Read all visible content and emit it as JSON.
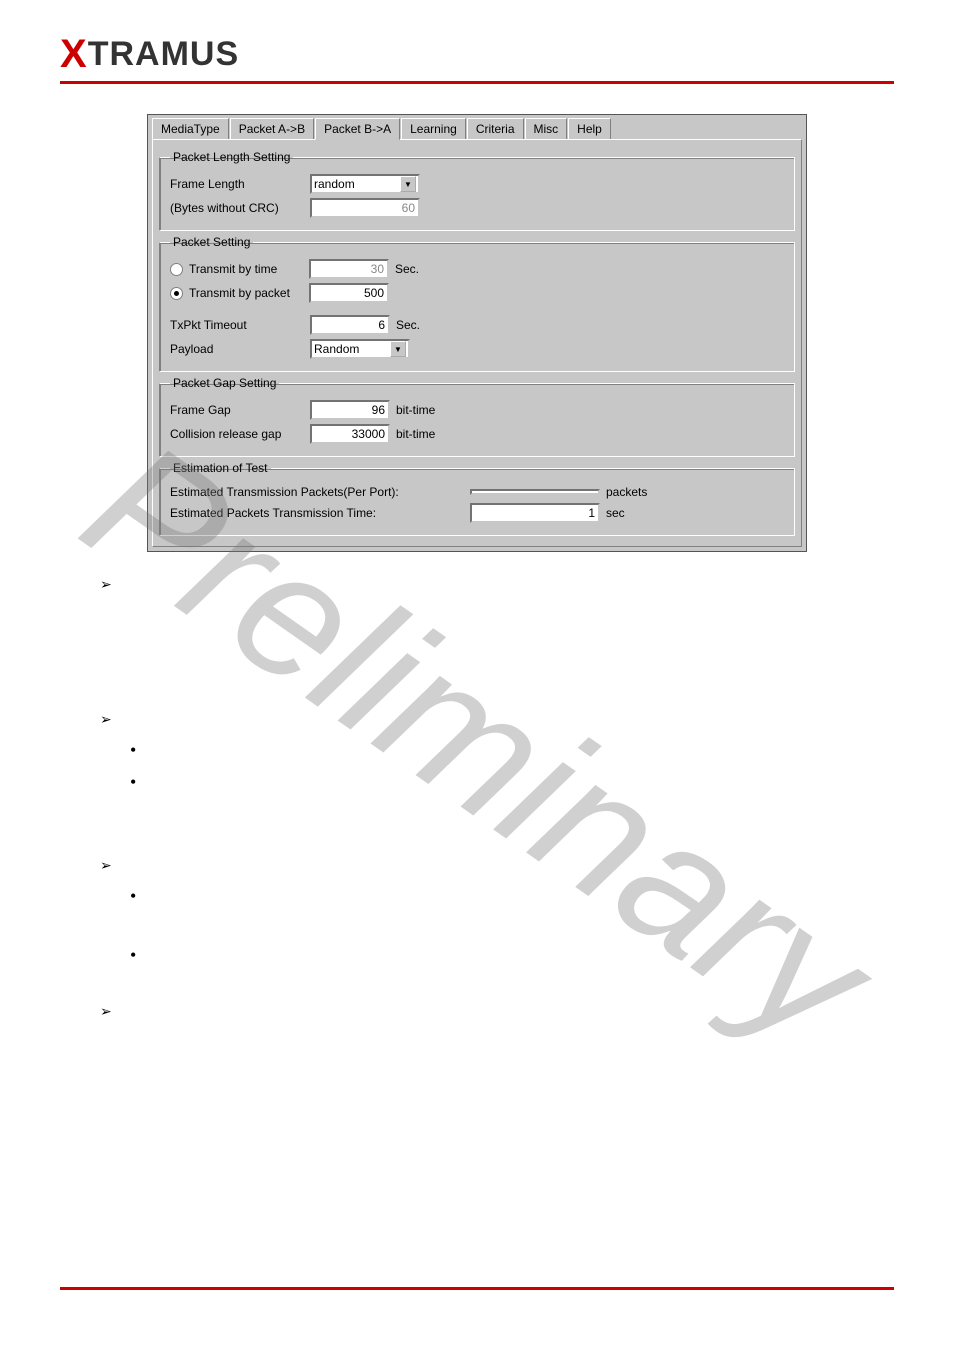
{
  "logo": {
    "x": "X",
    "rest": "TRAMUS"
  },
  "tabs": {
    "mediaType": "MediaType",
    "packetAB": "Packet A->B",
    "packetBA": "Packet B->A",
    "learning": "Learning",
    "criteria": "Criteria",
    "misc": "Misc",
    "help": "Help"
  },
  "packetLength": {
    "legend": "Packet Length Setting",
    "frameLengthLabel": "Frame Length",
    "frameLengthValue": "random",
    "bytesLabel": "(Bytes without CRC)",
    "bytesValue": "60"
  },
  "packetSetting": {
    "legend": "Packet Setting",
    "byTimeLabel": "Transmit by time",
    "byTimeValue": "30",
    "byTimeUnit": "Sec.",
    "byPacketLabel": "Transmit by packet",
    "byPacketValue": "500",
    "timeoutLabel": "TxPkt Timeout",
    "timeoutValue": "6",
    "timeoutUnit": "Sec.",
    "payloadLabel": "Payload",
    "payloadValue": "Random"
  },
  "packetGap": {
    "legend": "Packet Gap Setting",
    "frameGapLabel": "Frame Gap",
    "frameGapValue": "96",
    "frameGapUnit": "bit-time",
    "collisionLabel": "Collision release gap",
    "collisionValue": "33000",
    "collisionUnit": "bit-time"
  },
  "estimation": {
    "legend": "Estimation of Test",
    "pktsLabel": "Estimated Transmission Packets(Per Port):",
    "pktsValue": "",
    "pktsUnit": "packets",
    "timeLabel": "Estimated Packets Transmission Time:",
    "timeValue": "1",
    "timeUnit": "sec"
  },
  "watermark": "Preliminary"
}
